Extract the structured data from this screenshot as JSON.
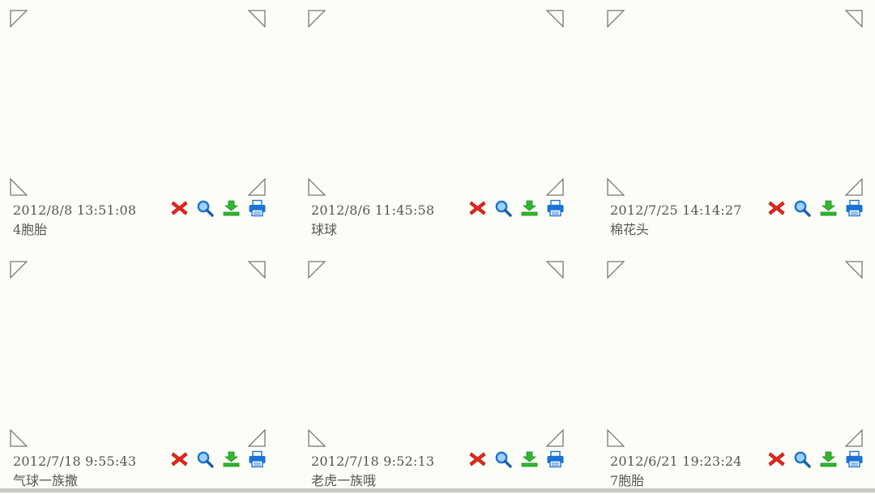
{
  "cards": [
    {
      "date": "2012/8/8  13:51:08",
      "name": "4胞胎"
    },
    {
      "date": "2012/8/6  11:45:58",
      "name": "球球"
    },
    {
      "date": "2012/7/25  14:14:27",
      "name": "棉花头"
    },
    {
      "date": "2012/7/18  9:55:43",
      "name": "气球一族撒"
    },
    {
      "date": "2012/7/18  9:52:13",
      "name": "老虎一族哦"
    },
    {
      "date": "2012/6/21  19:23:24",
      "name": "7胞胎"
    }
  ],
  "icons": {
    "delete": "delete-icon",
    "view": "zoom-icon",
    "download": "download-icon",
    "print": "print-icon"
  },
  "colors": {
    "delete": "#e8281c",
    "view": "#1a73d6",
    "download": "#2fb82f",
    "print": "#1a73d6"
  }
}
